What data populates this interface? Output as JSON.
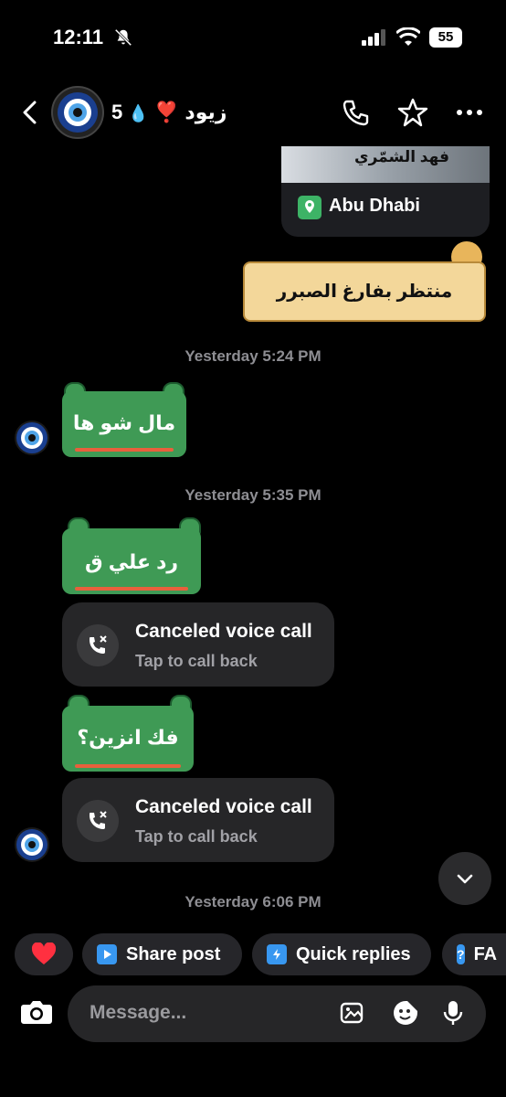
{
  "status_bar": {
    "time": "12:11",
    "battery": "55"
  },
  "header": {
    "name": "زيود ❣️",
    "streak": "5"
  },
  "location_card": {
    "image_caption": "فهد الشمّري",
    "label": "Abu Dhabi"
  },
  "messages": {
    "sticker_text": "منتظر بفارغ الصبرر",
    "ts1": "Yesterday 5:24 PM",
    "bubble1": "مال شو ها",
    "ts2": "Yesterday 5:35 PM",
    "bubble2": "رد علي ق",
    "call1": {
      "title": "Canceled voice call",
      "subtitle": "Tap to call back"
    },
    "bubble3": "فك انزين؟",
    "call2": {
      "title": "Canceled voice call",
      "subtitle": "Tap to call back"
    },
    "ts3": "Yesterday 6:06 PM"
  },
  "chips": {
    "share": "Share post",
    "quick": "Quick replies",
    "faq": "FA"
  },
  "composer": {
    "placeholder": "Message..."
  },
  "colors": {
    "frog_green": "#3f9a55",
    "accent_blue": "#3897f0",
    "heart": "#ff3040"
  }
}
